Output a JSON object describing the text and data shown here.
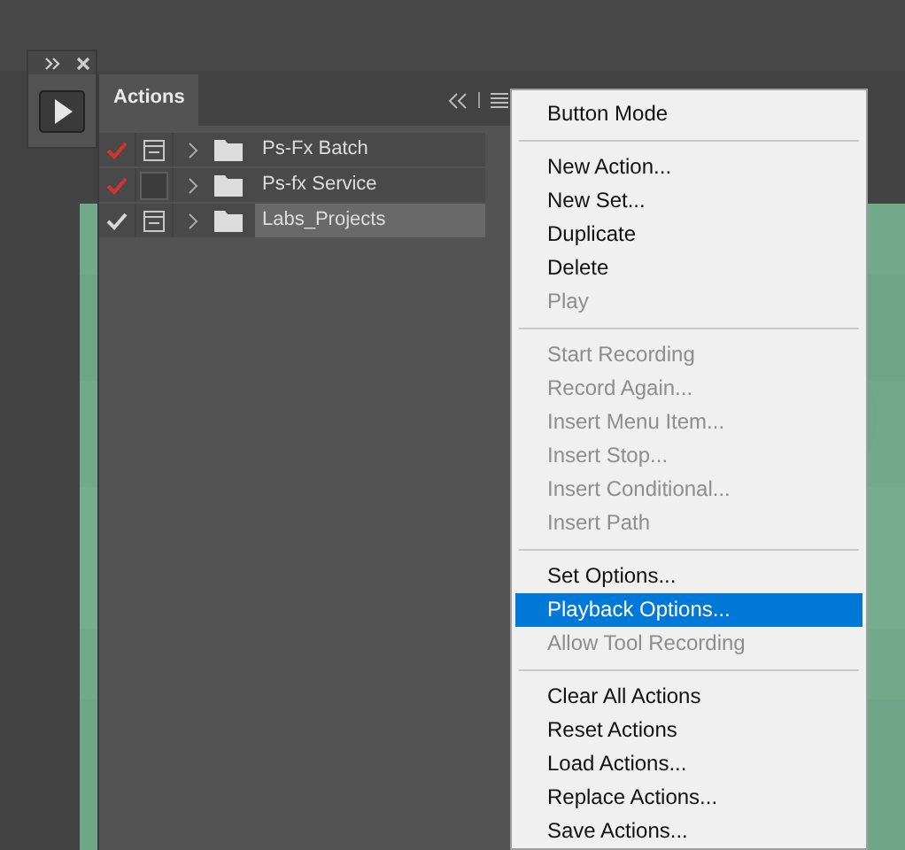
{
  "mini_panel": {
    "kind": "play"
  },
  "actions_panel": {
    "tab": {
      "label": "Actions",
      "selected": true
    },
    "sets": [
      {
        "name": "Ps-Fx Batch",
        "checked": true,
        "partial": true,
        "dialog": true,
        "expanded": false,
        "selected": false
      },
      {
        "name": "Ps-fx Service",
        "checked": true,
        "partial": true,
        "dialog": false,
        "expanded": false,
        "selected": false
      },
      {
        "name": "Labs_Projects",
        "checked": true,
        "partial": false,
        "dialog": true,
        "expanded": false,
        "selected": true
      }
    ]
  },
  "panel_menu": [
    {
      "kind": "item",
      "label": "Button Mode",
      "disabled": false,
      "selected": false
    },
    {
      "kind": "separator"
    },
    {
      "kind": "item",
      "label": "New Action...",
      "disabled": false,
      "selected": false
    },
    {
      "kind": "item",
      "label": "New Set...",
      "disabled": false,
      "selected": false
    },
    {
      "kind": "item",
      "label": "Duplicate",
      "disabled": false,
      "selected": false
    },
    {
      "kind": "item",
      "label": "Delete",
      "disabled": false,
      "selected": false
    },
    {
      "kind": "item",
      "label": "Play",
      "disabled": true,
      "selected": false
    },
    {
      "kind": "separator"
    },
    {
      "kind": "item",
      "label": "Start Recording",
      "disabled": true,
      "selected": false
    },
    {
      "kind": "item",
      "label": "Record Again...",
      "disabled": true,
      "selected": false
    },
    {
      "kind": "item",
      "label": "Insert Menu Item...",
      "disabled": true,
      "selected": false
    },
    {
      "kind": "item",
      "label": "Insert Stop...",
      "disabled": true,
      "selected": false
    },
    {
      "kind": "item",
      "label": "Insert Conditional...",
      "disabled": true,
      "selected": false
    },
    {
      "kind": "item",
      "label": "Insert Path",
      "disabled": true,
      "selected": false
    },
    {
      "kind": "separator"
    },
    {
      "kind": "item",
      "label": "Set Options...",
      "disabled": false,
      "selected": false
    },
    {
      "kind": "item",
      "label": "Playback Options...",
      "disabled": false,
      "selected": true
    },
    {
      "kind": "item",
      "label": "Allow Tool Recording",
      "disabled": true,
      "selected": false
    },
    {
      "kind": "separator"
    },
    {
      "kind": "item",
      "label": "Clear All Actions",
      "disabled": false,
      "selected": false
    },
    {
      "kind": "item",
      "label": "Reset Actions",
      "disabled": false,
      "selected": false
    },
    {
      "kind": "item",
      "label": "Load Actions...",
      "disabled": false,
      "selected": false
    },
    {
      "kind": "item",
      "label": "Replace Actions...",
      "disabled": false,
      "selected": false
    },
    {
      "kind": "item",
      "label": "Save Actions...",
      "disabled": false,
      "selected": false
    }
  ]
}
